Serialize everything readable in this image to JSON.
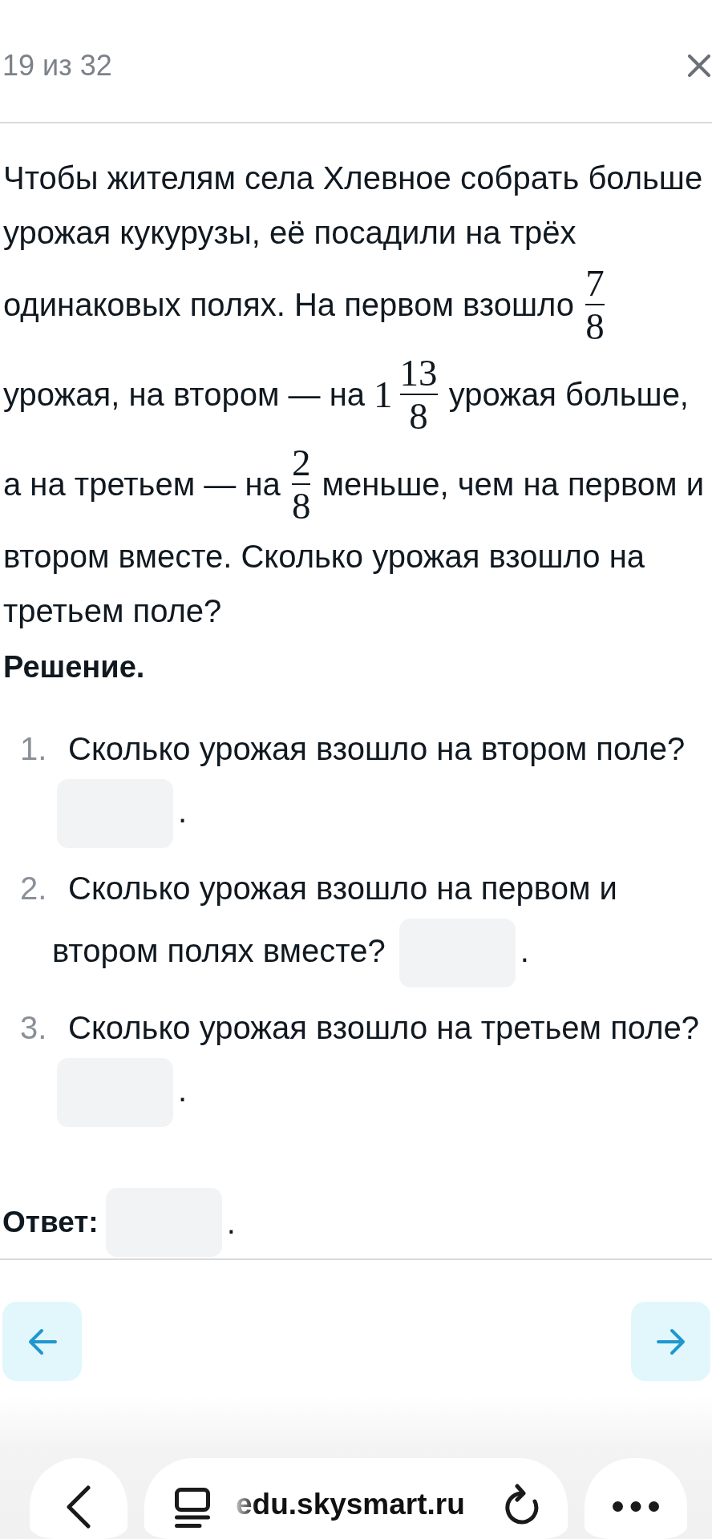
{
  "header": {
    "counter": "19 из 32"
  },
  "problem": {
    "lines": [
      [
        {
          "kind": "text",
          "text": "Чтобы жителям села Хлевное собрать больше"
        }
      ],
      [
        {
          "kind": "text",
          "text": "урожая кукурузы, её посадили на трёх"
        }
      ],
      [
        {
          "kind": "text",
          "text": "одинаковых полях. На первом взошло "
        },
        {
          "kind": "fraction",
          "numerator": "7",
          "denominator": "8"
        }
      ],
      [
        {
          "kind": "text",
          "text": "урожая, на втором — на "
        },
        {
          "kind": "mixed",
          "whole": "1",
          "numerator": "13",
          "denominator": "8"
        },
        {
          "kind": "text",
          "text": " урожая больше,"
        }
      ],
      [
        {
          "kind": "text",
          "text": "а на третьем — на "
        },
        {
          "kind": "fraction",
          "numerator": "2",
          "denominator": "8"
        },
        {
          "kind": "text",
          "text": " меньше, чем на первом и"
        }
      ],
      [
        {
          "kind": "text",
          "text": "втором вместе. Сколько урожая взошло на"
        }
      ],
      [
        {
          "kind": "text",
          "text": "третьем поле?"
        }
      ]
    ]
  },
  "solution": {
    "title": "Решение.",
    "steps": [
      {
        "number": "1.",
        "question_lines": [
          "Сколько урожая взошло на втором поле?"
        ],
        "end": "."
      },
      {
        "number": "2.",
        "question_lines": [
          "Сколько урожая взошло на первом и",
          "втором полях вместе?"
        ],
        "end": "."
      },
      {
        "number": "3.",
        "question_lines": [
          "Сколько урожая взошло на третьем поле?"
        ],
        "end": "."
      }
    ]
  },
  "answer": {
    "label": "Ответ:",
    "end": "."
  },
  "browser_bar": {
    "url": "edu.skysmart.ru"
  }
}
